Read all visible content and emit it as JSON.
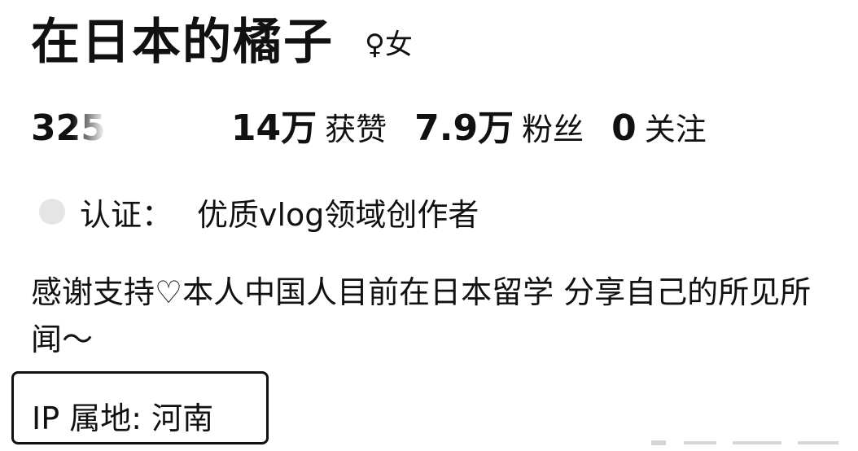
{
  "profile": {
    "name": "在日本的橘子",
    "gender": "♀女"
  },
  "stats": {
    "partial_value": "325",
    "likes_value": "14万",
    "likes_label": "获赞",
    "fans_value": "7.9万",
    "fans_label": "粉丝",
    "following_value": "0",
    "following_label": "关注"
  },
  "certification": {
    "label": "认证：",
    "value": "优质vlog领域创作者",
    "icon": "badge-icon"
  },
  "bio": {
    "text": "感谢支持♡本人中国人目前在日本留学 分享自己的所见所闻～"
  },
  "ip": {
    "label": "IP 属地: 河南"
  }
}
